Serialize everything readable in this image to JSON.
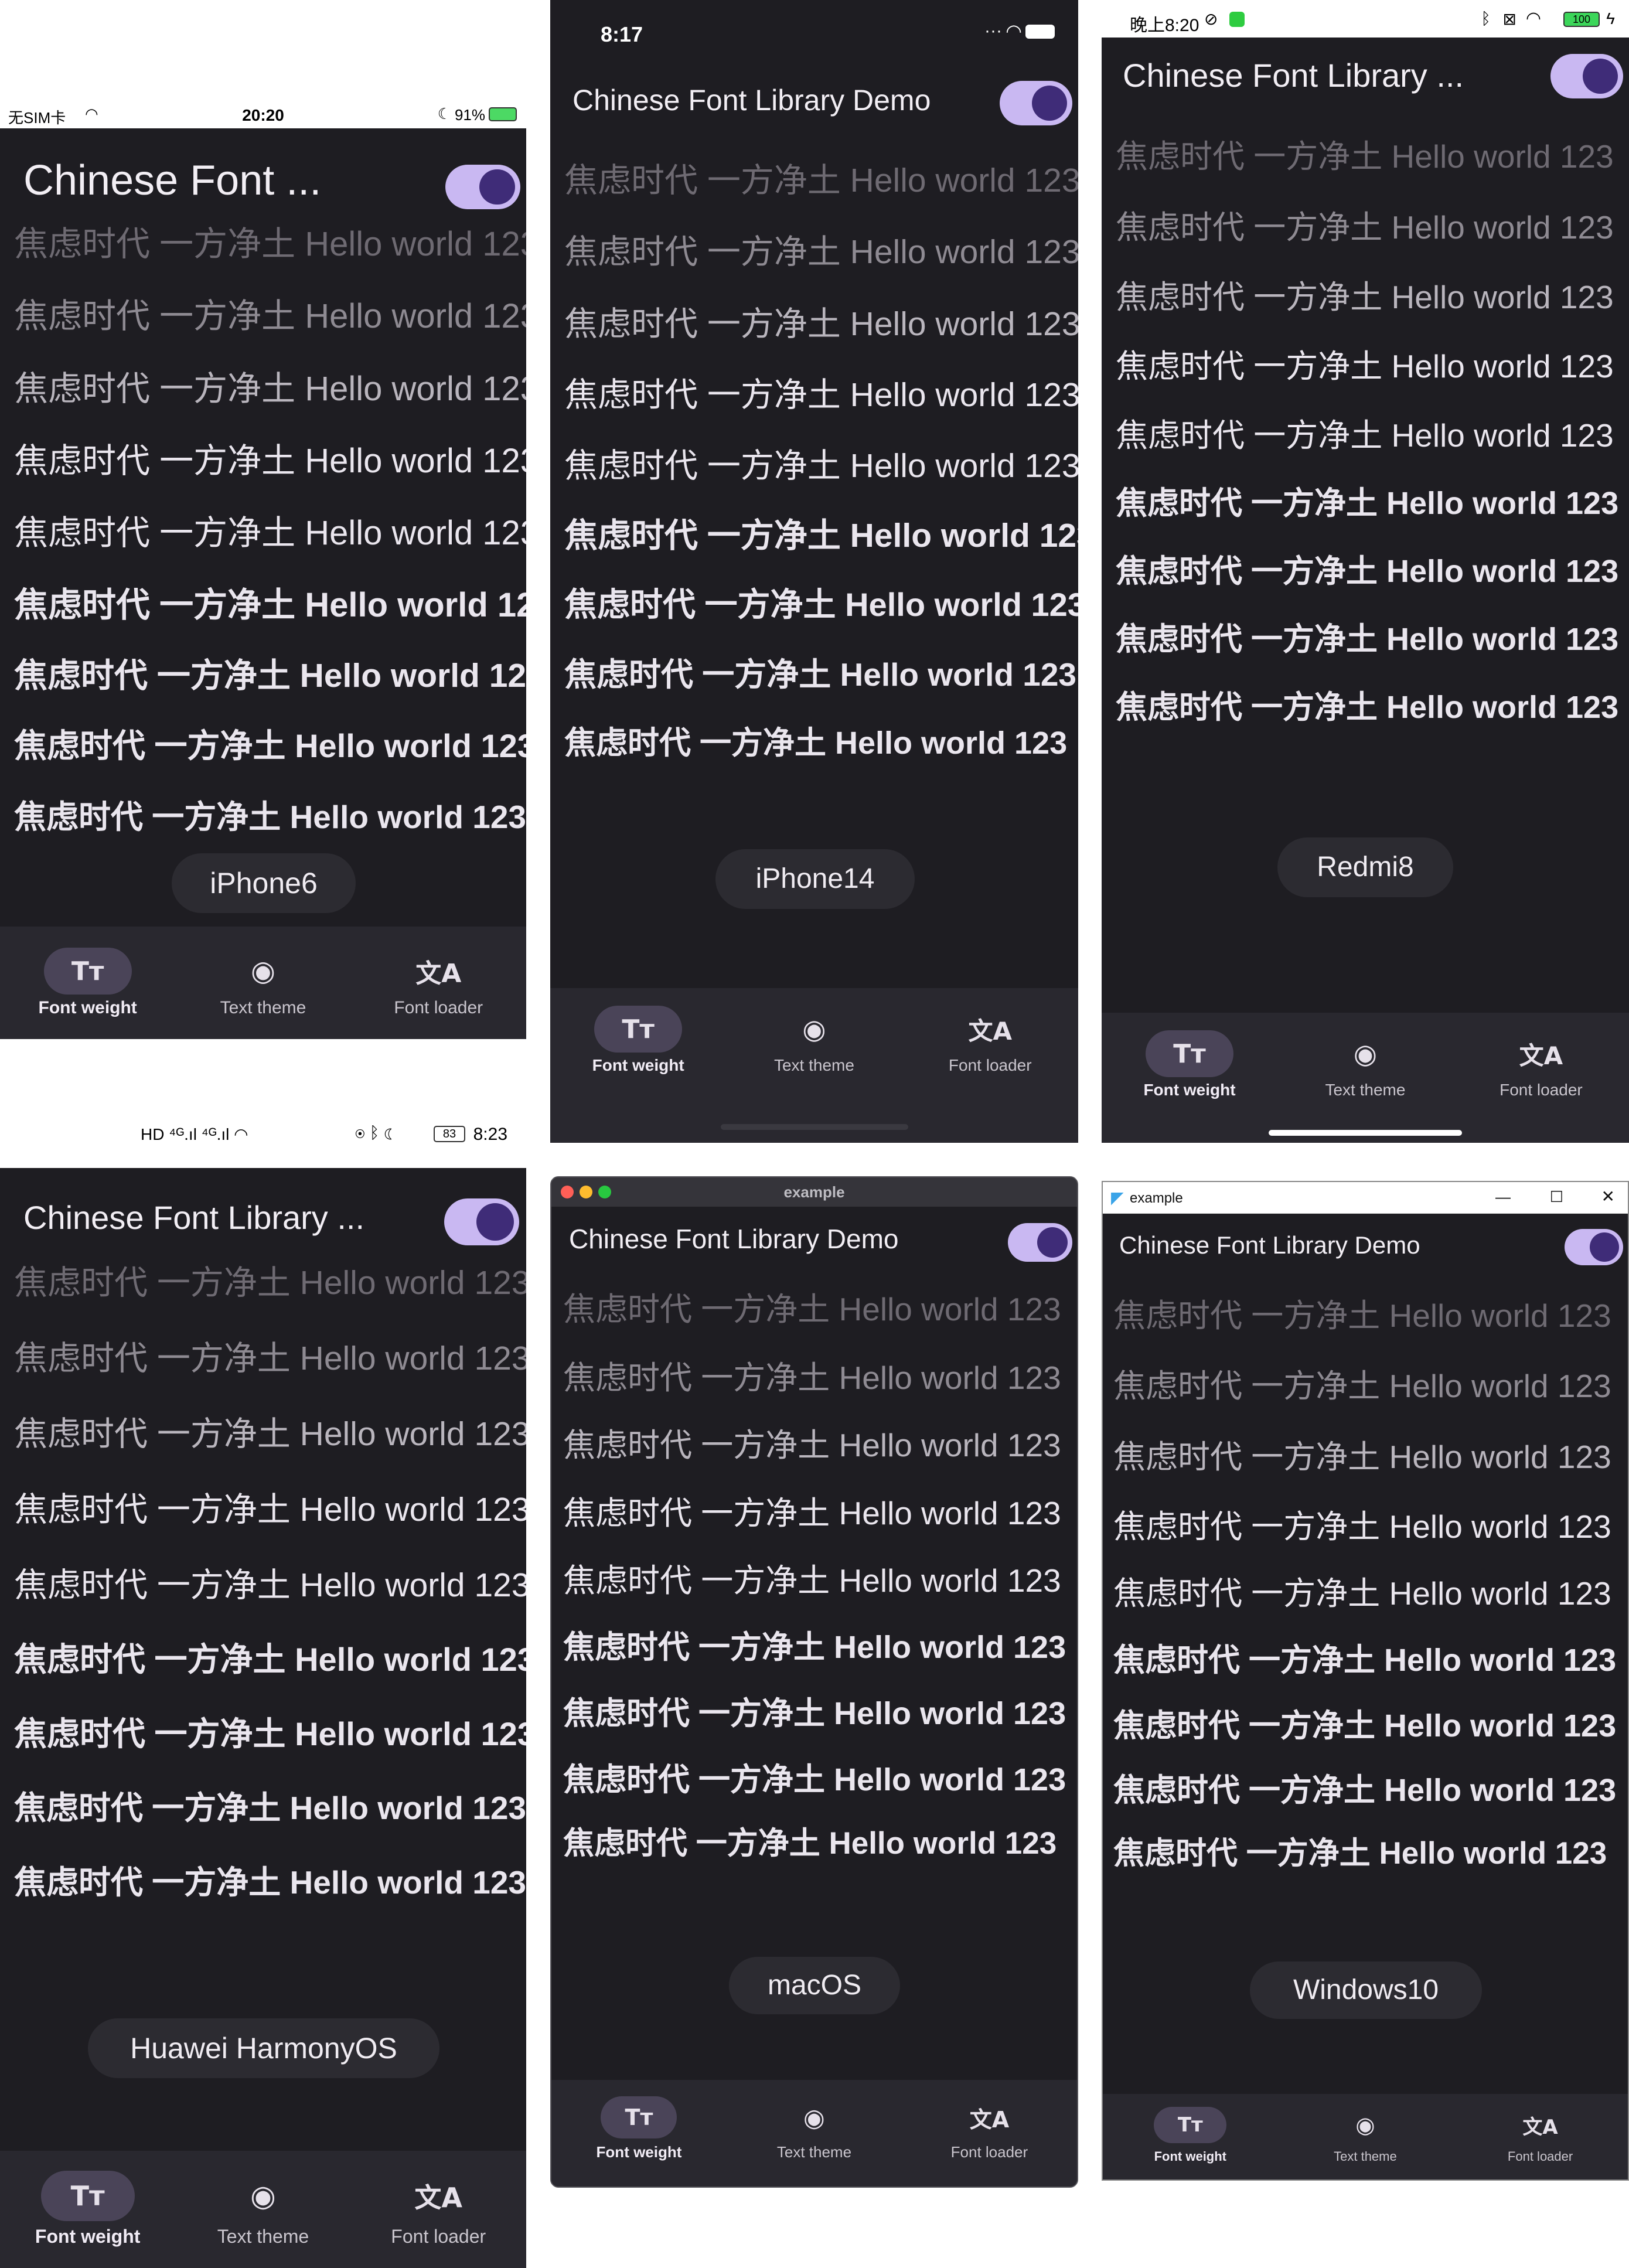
{
  "sample_text": "焦虑时代 一方净土 Hello world 123",
  "app_title_full": "Chinese Font Library Demo",
  "nav": [
    {
      "label": "Font weight",
      "icon": "text-fields-icon",
      "active": true
    },
    {
      "label": "Text theme",
      "icon": "palette-icon",
      "active": false
    },
    {
      "label": "Font loader",
      "icon": "translate-icon",
      "active": false
    }
  ],
  "devices": {
    "iphone6": {
      "status_left": "无SIM卡",
      "status_time": "20:20",
      "status_right": "91%",
      "title": "Chinese Font ...",
      "chip": "iPhone6"
    },
    "iphone14": {
      "status_time": "8:17",
      "title": "Chinese Font Library Demo",
      "chip": "iPhone14"
    },
    "redmi8": {
      "status_left": "晚上8:20",
      "status_right": "100",
      "title": "Chinese Font Library ...",
      "chip": "Redmi8"
    },
    "harmony": {
      "status_right": "8:23",
      "status_battery": "83",
      "title": "Chinese Font Library ...",
      "chip": "Huawei HarmonyOS"
    },
    "macos": {
      "window_title": "example",
      "title": "Chinese Font Library Demo",
      "chip": "macOS"
    },
    "windows": {
      "window_title": "example",
      "title": "Chinese Font Library Demo",
      "chip": "Windows10",
      "controls": [
        "—",
        "☐",
        "✕"
      ]
    }
  },
  "colors": {
    "background": "#1e1d22",
    "navbar": "#29282f",
    "toggle_track": "#c9b8f2",
    "toggle_knob": "#3f2c78",
    "active_pill": "#4a4458"
  }
}
